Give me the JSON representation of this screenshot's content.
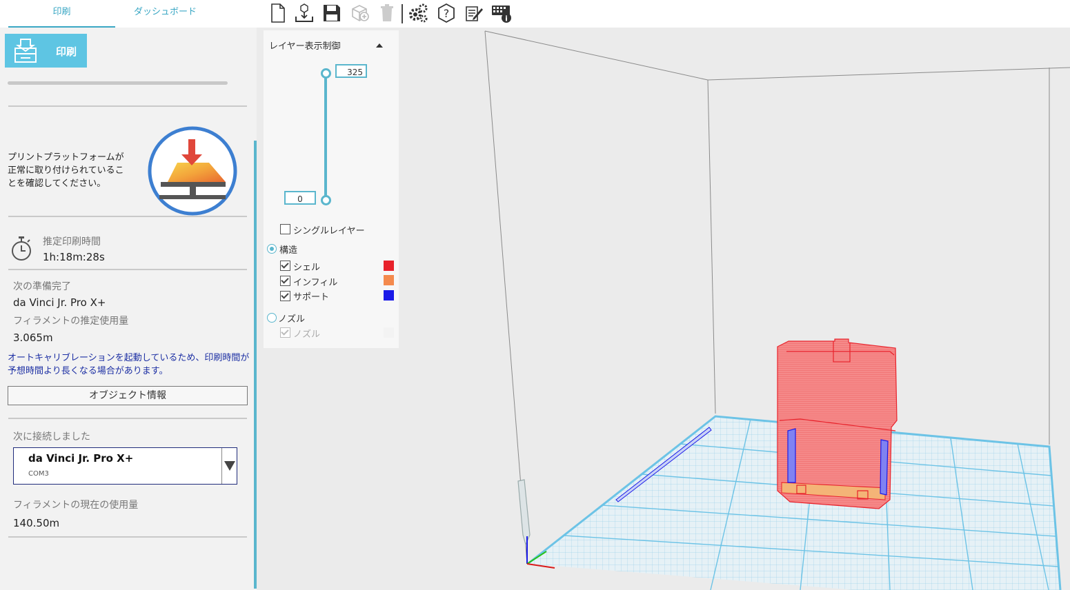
{
  "tabs": {
    "print": "印刷",
    "dashboard": "ダッシュボード"
  },
  "toolbar": {
    "icons": [
      "new-file-icon",
      "import-icon",
      "save-icon",
      "add-model-icon",
      "delete-icon",
      "settings-icon",
      "help-icon",
      "notes-icon",
      "keyboard-info-icon"
    ]
  },
  "sidebar": {
    "print_button_label": "印刷",
    "platform_message": "プリントプラットフォームが正常に取り付けられていることを確認してください。",
    "estimated_time_label": "推定印刷時間",
    "estimated_time_value": "1h:18m:28s",
    "ready_label": "次の準備完了",
    "ready_printer": "da Vinci Jr. Pro X+",
    "filament_estimate_label": "フィラメントの推定使用量",
    "filament_estimate_value": "3.065m",
    "auto_calibration_note": "オートキャリブレーションを起動しているため、印刷時間が予想時間より長くなる場合があります。",
    "object_info_button": "オブジェクト情報",
    "connected_label": "次に接続しました",
    "connected_printer": "da Vinci Jr. Pro X+",
    "connected_port": "COM3",
    "filament_current_label": "フィラメントの現在の使用量",
    "filament_current_value": "140.50m"
  },
  "layer_panel": {
    "title": "レイヤー表示制御",
    "max_layer": "325",
    "min_layer": "0",
    "single_layer_label": "シングルレイヤー",
    "structure_label": "構造",
    "shell_label": "シェル",
    "infill_label": "インフィル",
    "support_label": "サポート",
    "nozzle_radio_label": "ノズル",
    "nozzle_check_label": "ノズル",
    "colors": {
      "shell": "#e8222b",
      "infill": "#f48a4d",
      "support": "#1a1ae8",
      "accent": "#5ab6cd"
    }
  }
}
